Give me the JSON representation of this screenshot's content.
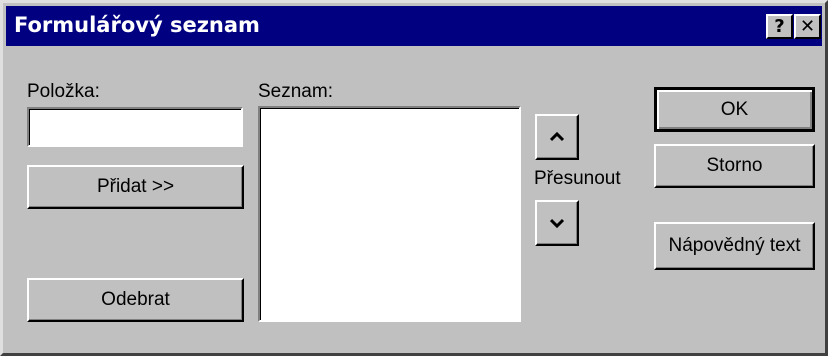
{
  "window": {
    "title": "Formulářový seznam",
    "help_label": "?",
    "close_label": "✕"
  },
  "item": {
    "label": "Položka:",
    "value": ""
  },
  "list": {
    "label": "Seznam:",
    "items": []
  },
  "buttons": {
    "add": "Přidat >>",
    "remove": "Odebrat",
    "ok": "OK",
    "cancel": "Storno",
    "help_text": "Nápovědný text"
  },
  "move": {
    "label": "Přesunout",
    "up_icon": "chevron-up-icon",
    "down_icon": "chevron-down-icon"
  }
}
